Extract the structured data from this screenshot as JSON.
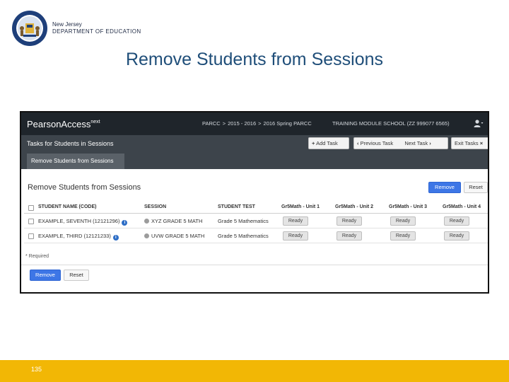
{
  "slide": {
    "org_line1": "New Jersey",
    "org_line2": "DEPARTMENT OF EDUCATION",
    "title": "Remove Students from Sessions",
    "page_number": "135",
    "colors": {
      "title": "#1f4e79",
      "footer": "#f2b705"
    }
  },
  "app": {
    "logo": "PearsonAccess",
    "logo_sup": "next",
    "breadcrumb": [
      "PARCC",
      "2015 - 2016",
      "2016 Spring PARCC"
    ],
    "school": "TRAINING MODULE SCHOOL (ZZ 999077 6565)",
    "user_menu_icon": "user-icon"
  },
  "taskbar": {
    "title": "Tasks for Students in Sessions",
    "add_task": "Add Task",
    "previous_task": "Previous Task",
    "next_task": "Next Task",
    "exit_tasks": "Exit Tasks"
  },
  "tabs": [
    "Remove Students from Sessions"
  ],
  "panel": {
    "title": "Remove Students from Sessions",
    "remove_button": "Remove",
    "reset_button": "Reset",
    "required_note": "* Required",
    "bottom_remove_button": "Remove",
    "bottom_reset_button": "Reset"
  },
  "table": {
    "columns": [
      "STUDENT NAME (CODE)",
      "SESSION",
      "STUDENT TEST",
      "Gr5Math - Unit 1",
      "Gr5Math - Unit 2",
      "Gr5Math - Unit 3",
      "Gr5Math - Unit 4"
    ],
    "rows": [
      {
        "student": "EXAMPLE, SEVENTH (12121296)",
        "session": "XYZ GRADE 5 MATH",
        "test": "Grade 5 Mathematics",
        "units": [
          "Ready",
          "Ready",
          "Ready",
          "Ready"
        ]
      },
      {
        "student": "EXAMPLE, THIRD (12121233)",
        "session": "UVW GRADE 5 MATH",
        "test": "Grade 5 Mathematics",
        "units": [
          "Ready",
          "Ready",
          "Ready",
          "Ready"
        ]
      }
    ]
  }
}
